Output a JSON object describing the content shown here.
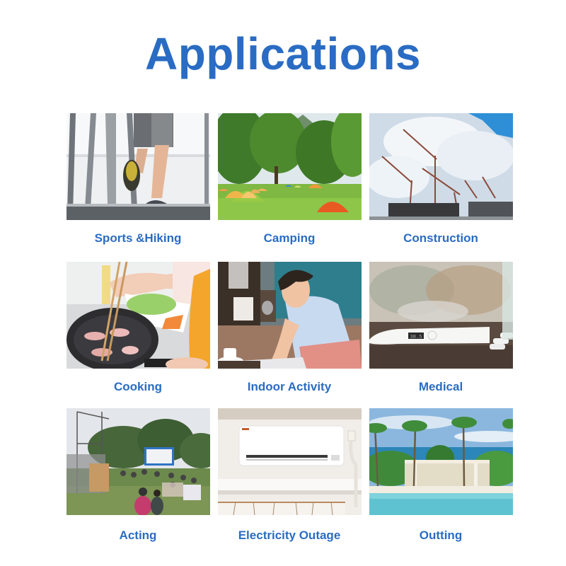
{
  "title": "Applications",
  "brand_color": "#2a6cc3",
  "applications": [
    {
      "label": "Sports &Hiking",
      "image": "treadmill-running-photo"
    },
    {
      "label": "Camping",
      "image": "campsite-tents-photo"
    },
    {
      "label": "Construction",
      "image": "construction-cranes-photo"
    },
    {
      "label": "Cooking",
      "image": "frying-pan-cooking-photo"
    },
    {
      "label": "Indoor Activity",
      "image": "man-on-laptop-photo"
    },
    {
      "label": "Medical",
      "image": "thermometer-pills-photo",
      "thermometer_reading": "38.5"
    },
    {
      "label": "Acting",
      "image": "outdoor-cinema-photo"
    },
    {
      "label": "Electricity Outage",
      "image": "air-conditioner-photo"
    },
    {
      "label": "Outting",
      "image": "resort-pool-photo"
    }
  ]
}
